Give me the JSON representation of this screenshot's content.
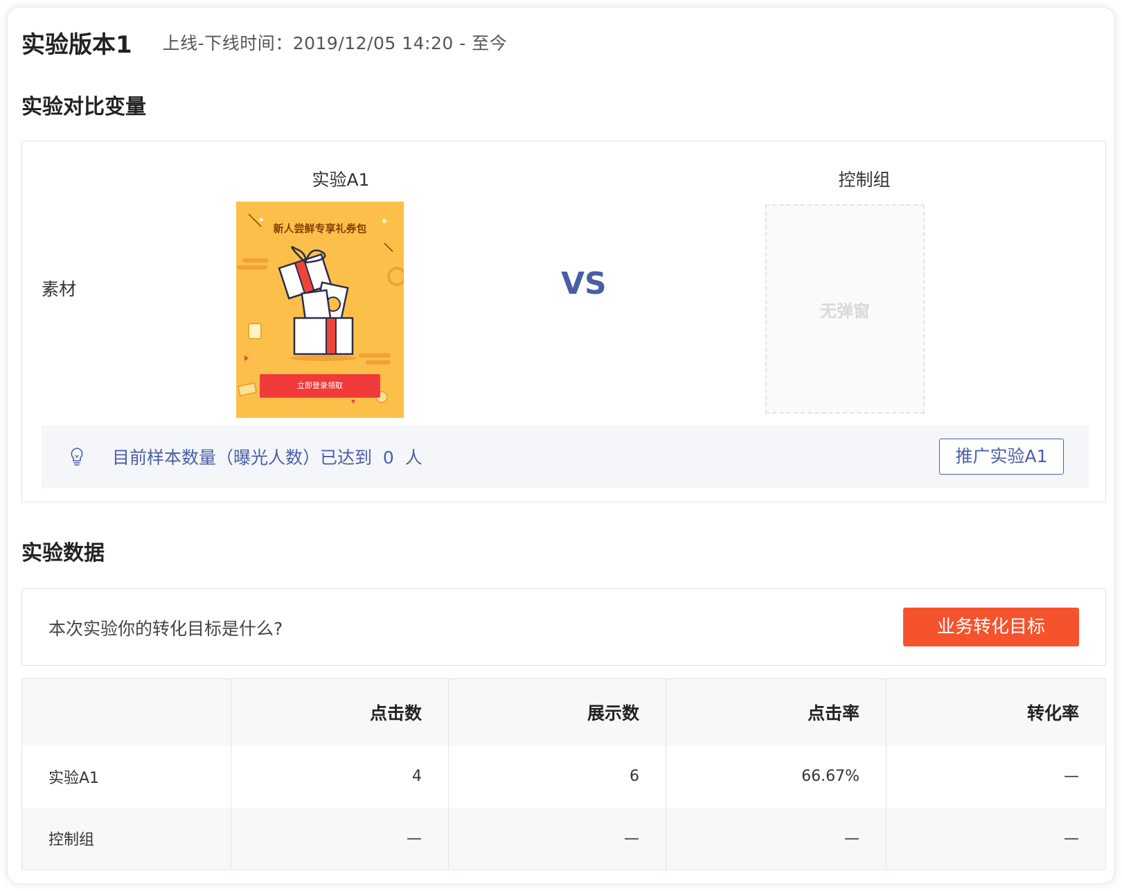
{
  "header": {
    "title": "实验版本1",
    "timeline": "上线-下线时间：2019/12/05 14:20 - 至今"
  },
  "compare": {
    "section_title": "实验对比变量",
    "group_a_label": "实验A1",
    "group_c_label": "控制组",
    "row_label": "素材",
    "material_title": "新人尝鲜专享礼券包",
    "material_button": "立即登录领取",
    "vs": "VS",
    "placeholder_text": "无弹窗",
    "notice_text": "目前样本数量（曝光人数）已达到  0  人",
    "promote_button": "推广实验A1"
  },
  "data_section": {
    "section_title": "实验数据",
    "goal_question": "本次实验你的转化目标是什么?",
    "goal_button": "业务转化目标",
    "columns": [
      "",
      "点击数",
      "展示数",
      "点击率",
      "转化率"
    ],
    "rows": [
      {
        "name": "实验A1",
        "clicks": "4",
        "views": "6",
        "ctr": "66.67%",
        "cvr": "—"
      },
      {
        "name": "控制组",
        "clicks": "—",
        "views": "—",
        "ctr": "—",
        "cvr": "—"
      }
    ]
  },
  "colors": {
    "accent_blue": "#4a5ea6",
    "accent_orange": "#f5532d",
    "material_bg": "#fcc04a",
    "material_button": "#f13a3a"
  }
}
